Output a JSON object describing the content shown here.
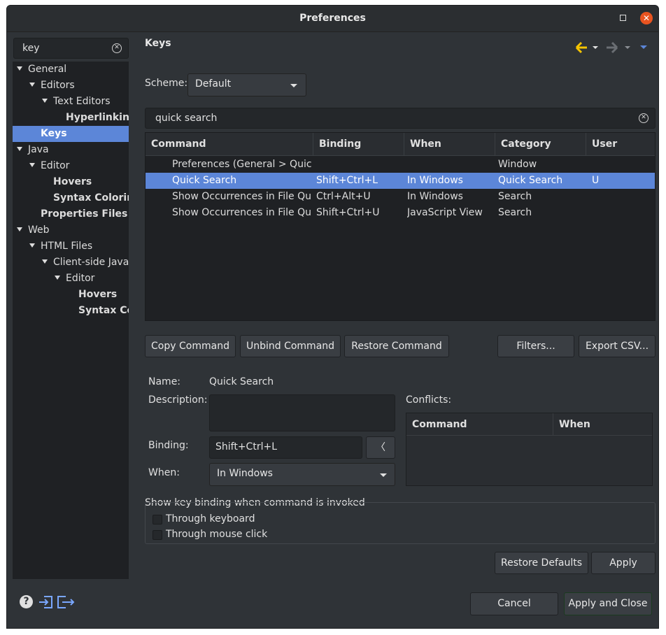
{
  "window": {
    "title": "Preferences"
  },
  "sidebar": {
    "search_value": "key",
    "tree": [
      {
        "label": "General"
      },
      {
        "label": "Editors"
      },
      {
        "label": "Text Editors"
      },
      {
        "label": "Hyperlinking"
      },
      {
        "label": "Keys"
      },
      {
        "label": "Java"
      },
      {
        "label": "Editor"
      },
      {
        "label": "Hovers"
      },
      {
        "label": "Syntax Coloring"
      },
      {
        "label": "Properties Files E"
      },
      {
        "label": "Web"
      },
      {
        "label": "HTML Files"
      },
      {
        "label": "Client-side JavaS"
      },
      {
        "label": "Editor"
      },
      {
        "label": "Hovers"
      },
      {
        "label": "Syntax Col"
      }
    ]
  },
  "page": {
    "title": "Keys",
    "scheme_label": "Scheme:",
    "scheme_value": "Default",
    "filter_value": "quick search"
  },
  "table": {
    "headers": [
      "Command",
      "Binding",
      "When",
      "Category",
      "User"
    ],
    "rows": [
      [
        "Preferences (General > Quick Search)",
        "",
        "",
        "Window",
        ""
      ],
      [
        "Quick Search",
        "Shift+Ctrl+L",
        "In Windows",
        "Quick Search",
        "U"
      ],
      [
        "Show Occurrences in File Quick Menu",
        "Ctrl+Alt+U",
        "In Windows",
        "Search",
        ""
      ],
      [
        "Show Occurrences in File Quick Menu",
        "Shift+Ctrl+U",
        "JavaScript View",
        "Search",
        ""
      ]
    ]
  },
  "buttons": {
    "copy_command": "Copy Command",
    "unbind_command": "Unbind Command",
    "restore_command": "Restore Command",
    "filters": "Filters...",
    "export_csv": "Export CSV...",
    "restore_defaults": "Restore Defaults",
    "apply": "Apply",
    "cancel": "Cancel",
    "apply_and_close": "Apply and Close"
  },
  "details": {
    "name_label": "Name:",
    "name_value": "Quick Search",
    "description_label": "Description:",
    "description_value": "",
    "binding_label": "Binding:",
    "binding_value": "Shift+Ctrl+L",
    "when_label": "When:",
    "when_value": "In Windows",
    "conflicts_label": "Conflicts:",
    "conflicts_headers": [
      "Command",
      "When"
    ]
  },
  "options": {
    "group_label": "Show key binding when command is invoked",
    "through_keyboard": "Through keyboard",
    "through_mouse": "Through mouse click"
  },
  "colors": {
    "selection": "#5c86d8",
    "close_button": "#e95420",
    "back_arrow": "#f5c400"
  }
}
